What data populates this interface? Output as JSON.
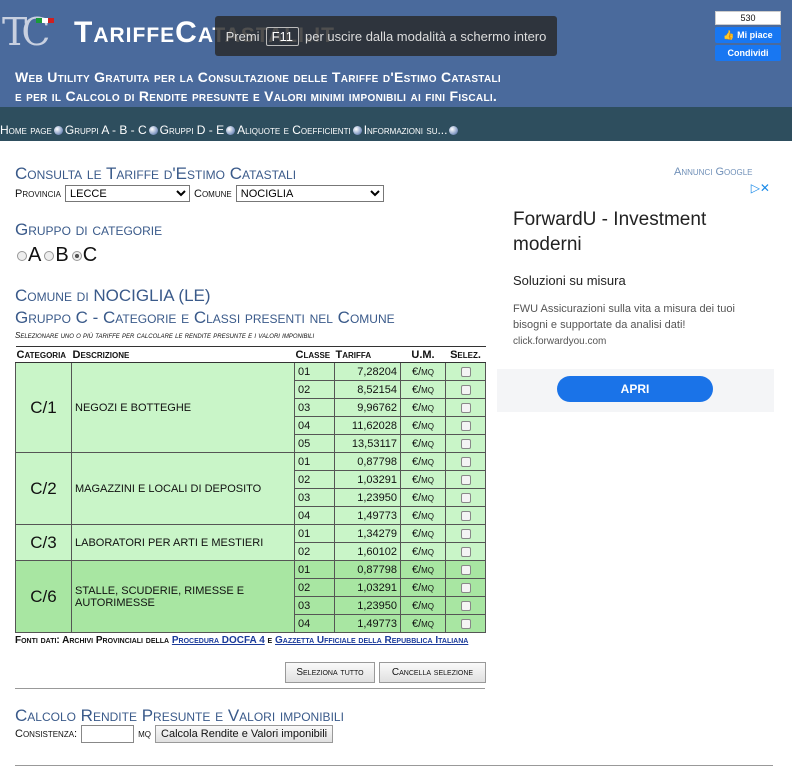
{
  "header": {
    "logo": "TC",
    "site_title": "TariffeCatastali.it",
    "subtitle_line1": "Web Utility Gratuita per la Consultazione delle Tariffe d'Estimo Catastali",
    "subtitle_line2": "e per il Calcolo di Rendite presunte e Valori minimi imponibili ai fini Fiscali.",
    "fullscreen_pre": "Premi",
    "fullscreen_key": "F11",
    "fullscreen_post": "per uscire dalla modalità a schermo intero",
    "fb_count": "530",
    "fb_like": "Mi piace",
    "fb_share": "Condividi"
  },
  "nav": [
    "Home page",
    "Gruppi A - B - C",
    "Gruppi D - E",
    "Aliquote e Coefficienti",
    "Informazioni su..."
  ],
  "consult": {
    "title": "Consulta le Tariffe d'Estimo Catastali",
    "provincia_label": "Provincia",
    "provincia_value": "LECCE",
    "comune_label": "Comune",
    "comune_value": "NOCIGLIA"
  },
  "group_select": {
    "title": "Gruppo di categorie",
    "options": [
      "A",
      "B",
      "C"
    ],
    "selected": "C"
  },
  "comune_title": "Comune di NOCIGLIA (LE)",
  "group_title": "Gruppo C - Categorie e Classi presenti nel Comune",
  "instruction": "Selezionare uno o più tariffe per calcolare le rendite presunte e i valori imponibili",
  "table": {
    "headers": [
      "Categoria",
      "Descrizione",
      "Classe",
      "Tariffa",
      "U.M.",
      "Selez."
    ],
    "groups": [
      {
        "code": "C/1",
        "desc": "NEGOZI E BOTTEGHE",
        "rows": [
          [
            "01",
            "7,28204"
          ],
          [
            "02",
            "8,52154"
          ],
          [
            "03",
            "9,96762"
          ],
          [
            "04",
            "11,62028"
          ],
          [
            "05",
            "13,53117"
          ]
        ]
      },
      {
        "code": "C/2",
        "desc": "MAGAZZINI E LOCALI DI DEPOSITO",
        "rows": [
          [
            "01",
            "0,87798"
          ],
          [
            "02",
            "1,03291"
          ],
          [
            "03",
            "1,23950"
          ],
          [
            "04",
            "1,49773"
          ]
        ]
      },
      {
        "code": "C/3",
        "desc": "LABORATORI PER ARTI E MESTIERI",
        "rows": [
          [
            "01",
            "1,34279"
          ],
          [
            "02",
            "1,60102"
          ]
        ]
      },
      {
        "code": "C/6",
        "desc": "STALLE, SCUDERIE, RIMESSE E AUTORIMESSE",
        "rows": [
          [
            "01",
            "0,87798"
          ],
          [
            "02",
            "1,03291"
          ],
          [
            "03",
            "1,23950"
          ],
          [
            "04",
            "1,49773"
          ]
        ]
      }
    ],
    "um": "€/mq"
  },
  "sources": {
    "prefix": "Fonti dati: Archivi Provinciali della",
    "link1": "Procedura DOCFA 4",
    "middle": "e",
    "link2": "Gazzetta Ufficiale della Repubblica Italiana"
  },
  "buttons": {
    "select_all": "Seleziona tutto",
    "cancel": "Cancella selezione"
  },
  "calc": {
    "title": "Calcolo Rendite Presunte e Valori imponibili",
    "consistenza_label": "Consistenza:",
    "consistenza_value": "",
    "unit": "mq",
    "button": "Calcola Rendite e Valori imponibili"
  },
  "ad": {
    "label": "Annunci Google",
    "title": "ForwardU - Investment moderni",
    "subtitle": "Soluzioni su misura",
    "text": "FWU Assicurazioni sulla vita a misura dei tuoi bisogni e supportate da analisi dati!",
    "url": "click.forwardyou.com",
    "cta": "APRI"
  }
}
